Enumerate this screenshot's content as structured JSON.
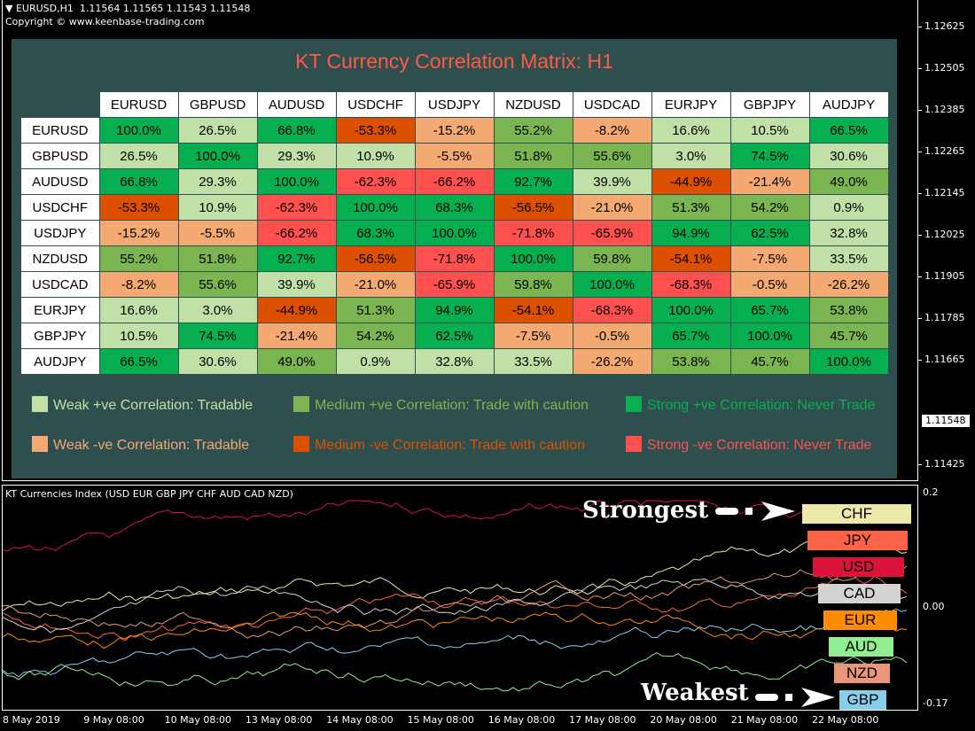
{
  "chart_header": {
    "symbol": "EURUSD,H1",
    "ohlc": "1.11564 1.11565 1.11543 1.11548",
    "copyright": "Copyright © www.keenbase-trading.com"
  },
  "price_axis": {
    "ticks": [
      "1.12625",
      "1.12505",
      "1.12385",
      "1.12265",
      "1.12145",
      "1.12025",
      "1.11905",
      "1.11785",
      "1.11665",
      "1.11425"
    ],
    "current_price": "1.11548"
  },
  "matrix": {
    "title": "KT Currency Correlation Matrix: H1",
    "columns": [
      "EURUSD",
      "GBPUSD",
      "AUDUSD",
      "USDCHF",
      "USDJPY",
      "NZDUSD",
      "USDCAD",
      "EURJPY",
      "GBPJPY",
      "AUDJPY"
    ],
    "rows": [
      {
        "label": "EURUSD",
        "values": [
          "100.0%",
          "26.5%",
          "66.8%",
          "-53.3%",
          "-15.2%",
          "55.2%",
          "-8.2%",
          "16.6%",
          "10.5%",
          "66.5%"
        ]
      },
      {
        "label": "GBPUSD",
        "values": [
          "26.5%",
          "100.0%",
          "29.3%",
          "10.9%",
          "-5.5%",
          "51.8%",
          "55.6%",
          "3.0%",
          "74.5%",
          "30.6%"
        ]
      },
      {
        "label": "AUDUSD",
        "values": [
          "66.8%",
          "29.3%",
          "100.0%",
          "-62.3%",
          "-66.2%",
          "92.7%",
          "39.9%",
          "-44.9%",
          "-21.4%",
          "49.0%"
        ]
      },
      {
        "label": "USDCHF",
        "values": [
          "-53.3%",
          "10.9%",
          "-62.3%",
          "100.0%",
          "68.3%",
          "-56.5%",
          "-21.0%",
          "51.3%",
          "54.2%",
          "0.9%"
        ]
      },
      {
        "label": "USDJPY",
        "values": [
          "-15.2%",
          "-5.5%",
          "-66.2%",
          "68.3%",
          "100.0%",
          "-71.8%",
          "-65.9%",
          "94.9%",
          "62.5%",
          "32.8%"
        ]
      },
      {
        "label": "NZDUSD",
        "values": [
          "55.2%",
          "51.8%",
          "92.7%",
          "-56.5%",
          "-71.8%",
          "100.0%",
          "59.8%",
          "-54.1%",
          "-7.5%",
          "33.5%"
        ]
      },
      {
        "label": "USDCAD",
        "values": [
          "-8.2%",
          "55.6%",
          "39.9%",
          "-21.0%",
          "-65.9%",
          "59.8%",
          "100.0%",
          "-68.3%",
          "-0.5%",
          "-26.2%"
        ]
      },
      {
        "label": "EURJPY",
        "values": [
          "16.6%",
          "3.0%",
          "-44.9%",
          "51.3%",
          "94.9%",
          "-54.1%",
          "-68.3%",
          "100.0%",
          "65.7%",
          "53.8%"
        ]
      },
      {
        "label": "GBPJPY",
        "values": [
          "10.5%",
          "74.5%",
          "-21.4%",
          "54.2%",
          "62.5%",
          "-7.5%",
          "-0.5%",
          "65.7%",
          "100.0%",
          "45.7%"
        ]
      },
      {
        "label": "AUDJPY",
        "values": [
          "66.5%",
          "30.6%",
          "49.0%",
          "0.9%",
          "32.8%",
          "33.5%",
          "-26.2%",
          "53.8%",
          "45.7%",
          "100.0%"
        ]
      }
    ],
    "colors": {
      "weak_pos": "#c0e0a8",
      "medium_pos": "#7ab552",
      "strong_pos": "#06b050",
      "weak_neg": "#f4a872",
      "medium_neg": "#dc5000",
      "strong_neg": "#ff5050"
    },
    "legend": [
      {
        "key": "weak_pos",
        "label": "Weak +ve Correlation: Tradable"
      },
      {
        "key": "medium_pos",
        "label": "Medium +ve Correlation: Trade with caution"
      },
      {
        "key": "strong_pos",
        "label": "Strong +ve Correlation: Never Trade"
      },
      {
        "key": "weak_neg",
        "label": "Weak -ve Correlation: Tradable"
      },
      {
        "key": "medium_neg",
        "label": "Medium -ve Correlation: Trade with caution"
      },
      {
        "key": "strong_neg",
        "label": "Strong -ve Correlation: Never Trade"
      }
    ]
  },
  "indicator": {
    "title": "KT Currencies Index (USD EUR GBP JPY CHF AUD CAD NZD)",
    "axis_labels": [
      "0.2",
      "0.00",
      "-0.17"
    ],
    "strongest_label": "Strongest",
    "weakest_label": "Weakest",
    "ranking": [
      {
        "currency": "CHF",
        "color": "#eee8aa"
      },
      {
        "currency": "JPY",
        "color": "#ff6347"
      },
      {
        "currency": "USD",
        "color": "#dc143c"
      },
      {
        "currency": "CAD",
        "color": "#d3d3d3"
      },
      {
        "currency": "EUR",
        "color": "#ff8c00"
      },
      {
        "currency": "AUD",
        "color": "#90ee90"
      },
      {
        "currency": "NZD",
        "color": "#e9967a"
      },
      {
        "currency": "GBP",
        "color": "#87ceeb"
      }
    ]
  },
  "time_axis": [
    "8 May 2019",
    "9 May 08:00",
    "10 May 08:00",
    "13 May 08:00",
    "14 May 08:00",
    "15 May 08:00",
    "16 May 08:00",
    "17 May 08:00",
    "20 May 08:00",
    "21 May 08:00",
    "22 May 08:00"
  ]
}
